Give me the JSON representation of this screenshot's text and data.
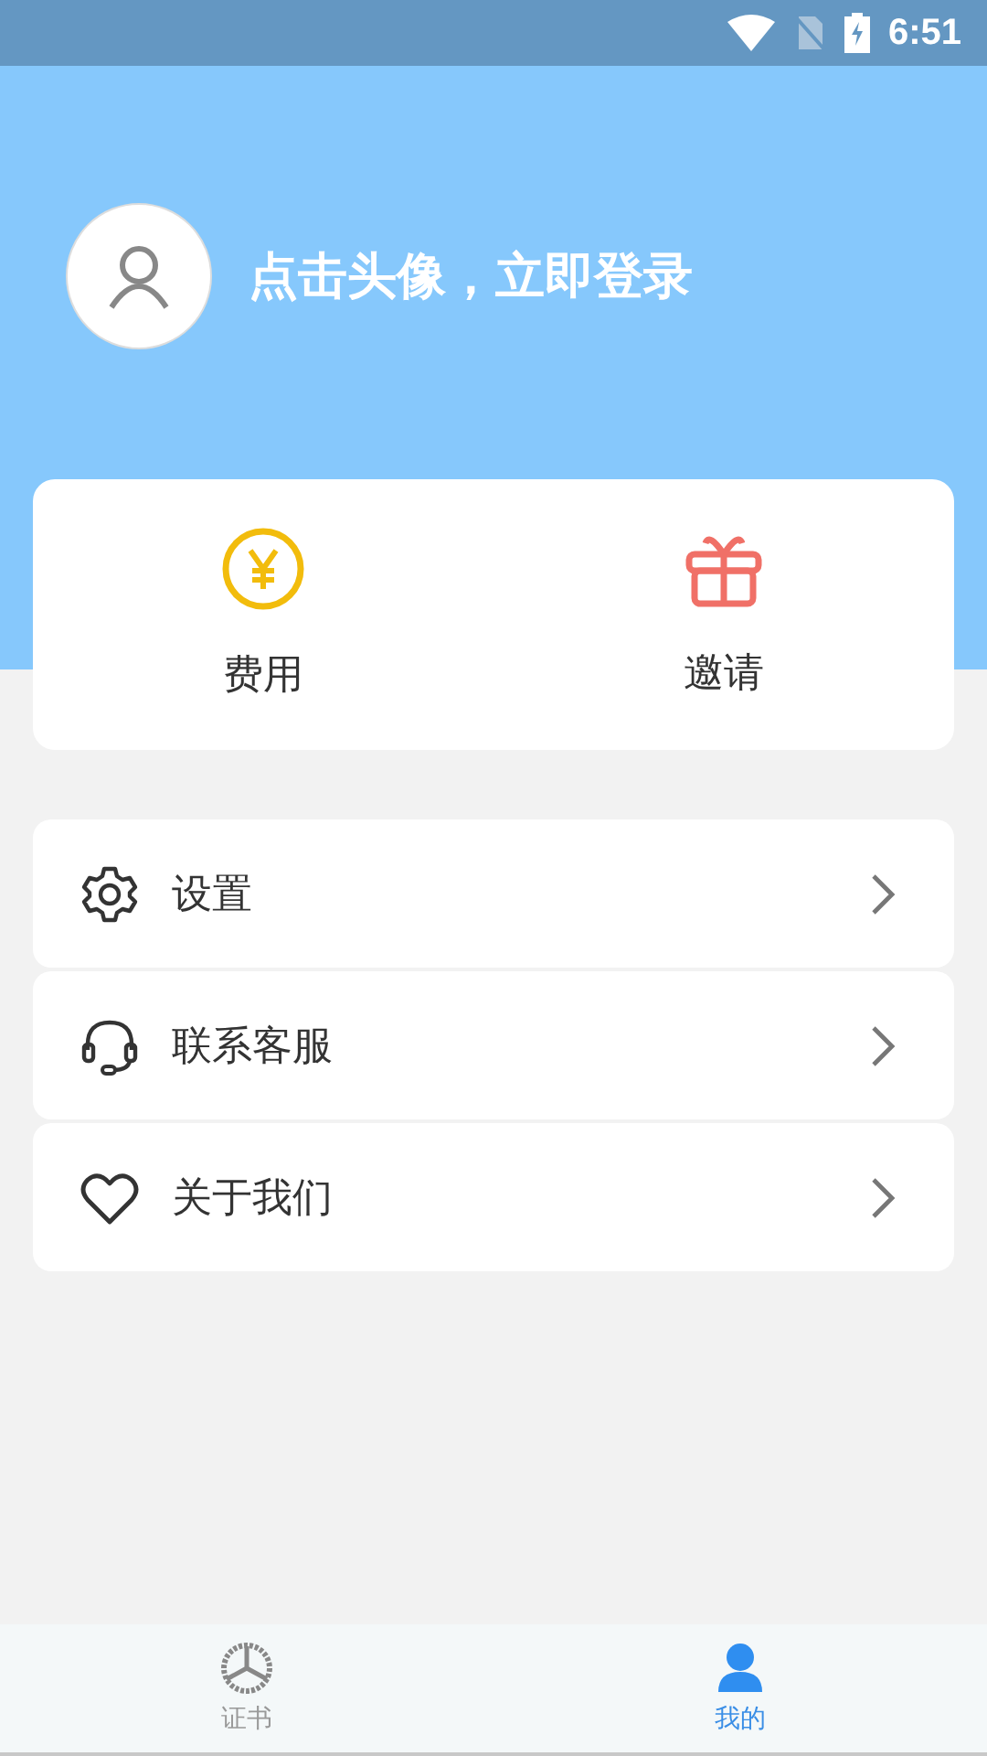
{
  "status_bar": {
    "time": "6:51"
  },
  "profile": {
    "login_prompt": "点击头像，立即登录"
  },
  "quick_actions": [
    {
      "kind": "coin",
      "label": "费用"
    },
    {
      "kind": "gift",
      "label": "邀请"
    }
  ],
  "menu": [
    {
      "kind": "gear",
      "label": "设置"
    },
    {
      "kind": "headset",
      "label": "联系客服"
    },
    {
      "kind": "heart",
      "label": "关于我们"
    }
  ],
  "tab_bar": [
    {
      "kind": "wheel",
      "label": "证书",
      "selected": false
    },
    {
      "kind": "person",
      "label": "我的",
      "selected": true
    }
  ]
}
